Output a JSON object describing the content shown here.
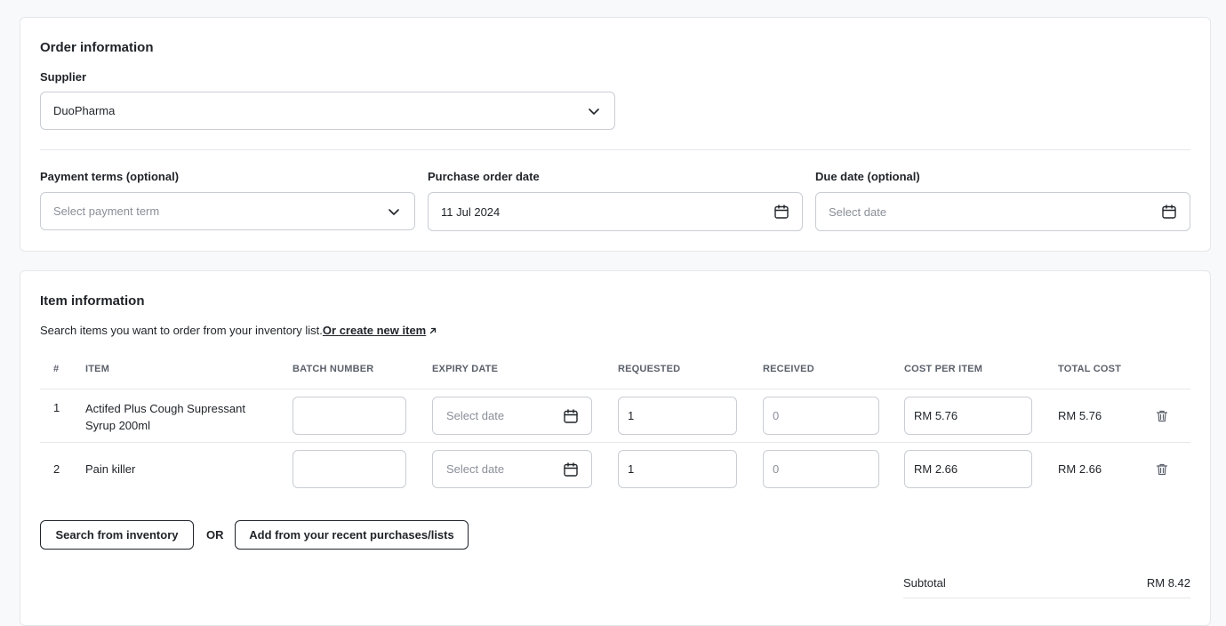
{
  "order": {
    "title": "Order information",
    "supplier_label": "Supplier",
    "supplier_value": "DuoPharma",
    "payment_label": "Payment terms (optional)",
    "payment_placeholder": "Select payment term",
    "po_date_label": "Purchase order date",
    "po_date_value": "11 Jul 2024",
    "due_date_label": "Due date (optional)",
    "due_date_placeholder": "Select date"
  },
  "items": {
    "title": "Item information",
    "description": "Search items you want to order from your inventory list.",
    "create_link": "Or create new item",
    "columns": [
      "#",
      "ITEM",
      "BATCH NUMBER",
      "EXPIRY DATE",
      "REQUESTED",
      "RECEIVED",
      "COST PER ITEM",
      "TOTAL COST"
    ],
    "rows": [
      {
        "num": "1",
        "name_line1": "Actifed Plus Cough Supressant",
        "name_line2": "Syrup 200ml",
        "batch": "",
        "expiry_placeholder": "Select date",
        "requested": "1",
        "received_placeholder": "0",
        "cost": "RM 5.76",
        "total": "RM 5.76"
      },
      {
        "num": "2",
        "name_line1": "Pain killer",
        "name_line2": "",
        "batch": "",
        "expiry_placeholder": "Select date",
        "requested": "1",
        "received_placeholder": "0",
        "cost": "RM 2.66",
        "total": "RM 2.66"
      }
    ],
    "search_button": "Search from inventory",
    "or_text": "OR",
    "recent_button": "Add from your recent purchases/lists",
    "subtotal_label": "Subtotal",
    "subtotal_value": "RM 8.42"
  },
  "icons": {
    "chevron": "chevron-down-icon",
    "calendar": "calendar-icon",
    "trash": "trash-icon",
    "external": "external-link-icon"
  }
}
